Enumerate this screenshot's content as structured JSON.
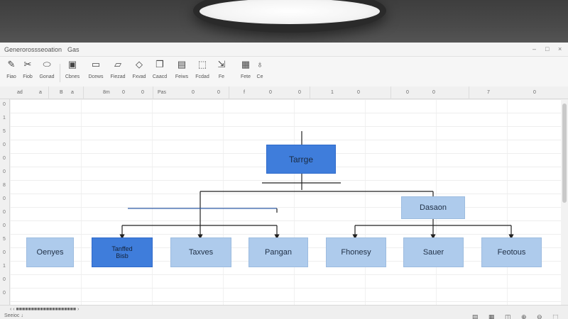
{
  "window": {
    "title": "Generorossseoation",
    "menu": "Gas",
    "controls": [
      "–",
      "□",
      "×"
    ]
  },
  "toolbar": {
    "tools": [
      {
        "icon": "pen-icon",
        "glyph": "✎",
        "label": "Fiao"
      },
      {
        "icon": "scissors-icon",
        "glyph": "✂",
        "label": "Fiob"
      },
      {
        "icon": "shape-icon",
        "glyph": "⬭",
        "label": "Gonad"
      },
      {
        "icon": "image-icon",
        "glyph": "▣",
        "label": "Cbnes"
      },
      {
        "icon": "video-icon",
        "glyph": "▭",
        "label": "Dcews"
      },
      {
        "icon": "edit-icon",
        "glyph": "▱",
        "label": "Fiezad"
      },
      {
        "icon": "draw-icon",
        "glyph": "◇",
        "label": "Fxvad"
      },
      {
        "icon": "copy-icon",
        "glyph": "❐",
        "label": "Caacd"
      },
      {
        "icon": "frame-icon",
        "glyph": "▤",
        "label": "Feiws"
      },
      {
        "icon": "grid-icon",
        "glyph": "⬚",
        "label": "Fcdad"
      },
      {
        "icon": "link-icon",
        "glyph": "⇲",
        "label": "Fe"
      },
      {
        "icon": "table-icon",
        "glyph": "▦",
        "label": "Fete"
      },
      {
        "icon": "bulb-icon",
        "glyph": "♁",
        "label": "Ce"
      }
    ]
  },
  "grid": {
    "columns": [
      "ad",
      "a",
      "B",
      "a",
      "8m",
      "0",
      "0",
      "Pas",
      "0",
      "0",
      "f",
      "0",
      "0",
      "1",
      "0",
      "0",
      "0",
      "7",
      "0"
    ],
    "rows": [
      "0",
      "1",
      "5",
      "0",
      "0",
      "0",
      "8",
      "0",
      "0",
      "0",
      "5",
      "0",
      "1",
      "0",
      "0",
      "0"
    ]
  },
  "diagram": {
    "nodes": {
      "root": "Tarrge",
      "mid": "Dasaon",
      "l1": "Oenyes",
      "l2a": "Tanffed",
      "l2b": "Bisb",
      "l3": "Taxves",
      "l4": "Pangan",
      "l5": "Fhonesy",
      "l6": "Sauer",
      "l7": "Feotous"
    }
  },
  "status": {
    "left": "‹ ‹ ■■■■■■■■■■■■■■■■■■■■ ›",
    "left2": "Seeioc ↓",
    "right": "▤ ▦ ◫ ⊕ ⊖ ⬚"
  },
  "colors": {
    "root_node": "#3f7ddb",
    "child_node": "#aecbec",
    "connector": "#222222"
  }
}
